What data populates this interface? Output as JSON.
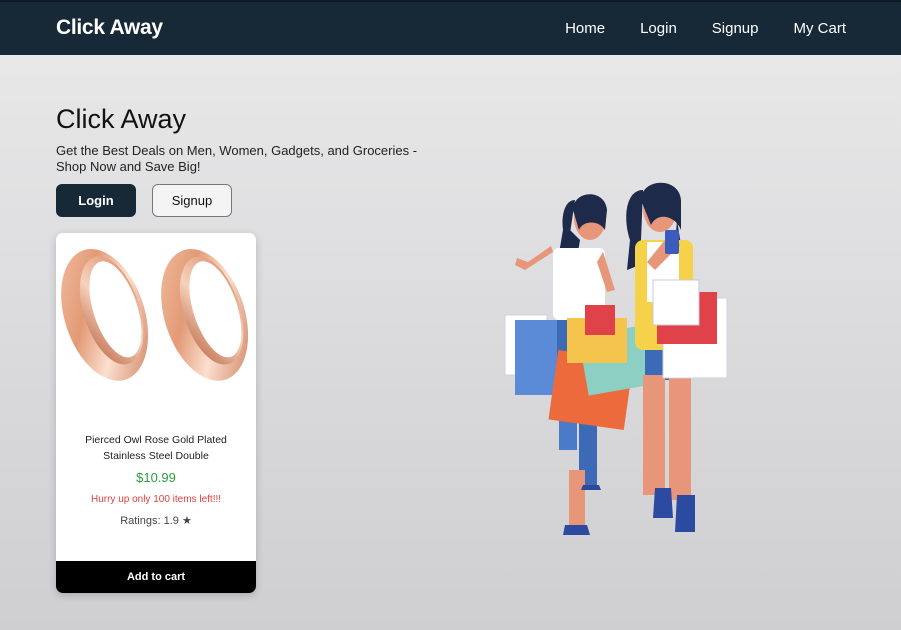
{
  "navbar": {
    "brand": "Click Away",
    "links": [
      {
        "label": "Home"
      },
      {
        "label": "Login"
      },
      {
        "label": "Signup"
      },
      {
        "label": "My Cart"
      }
    ]
  },
  "hero": {
    "title": "Click Away",
    "subtitle": "Get the Best Deals on Men, Women, Gadgets, and Groceries - Shop Now and Save Big!",
    "login_label": "Login",
    "signup_label": "Signup"
  },
  "product": {
    "title": "Pierced Owl Rose Gold Plated Stainless Steel Double",
    "price": "$10.99",
    "stock": "Hurry up only 100 items left!!!",
    "rating": "Ratings: 1.9 ★",
    "add_to_cart_label": "Add to cart",
    "image_icon": "rose-gold-tunnel-earrings"
  },
  "hero_image_icon": "shopping-women-illustration",
  "colors": {
    "navbar": "#172836",
    "price": "#2e9b3c",
    "stock_warning": "#e04040",
    "cart_button": "#000000"
  }
}
